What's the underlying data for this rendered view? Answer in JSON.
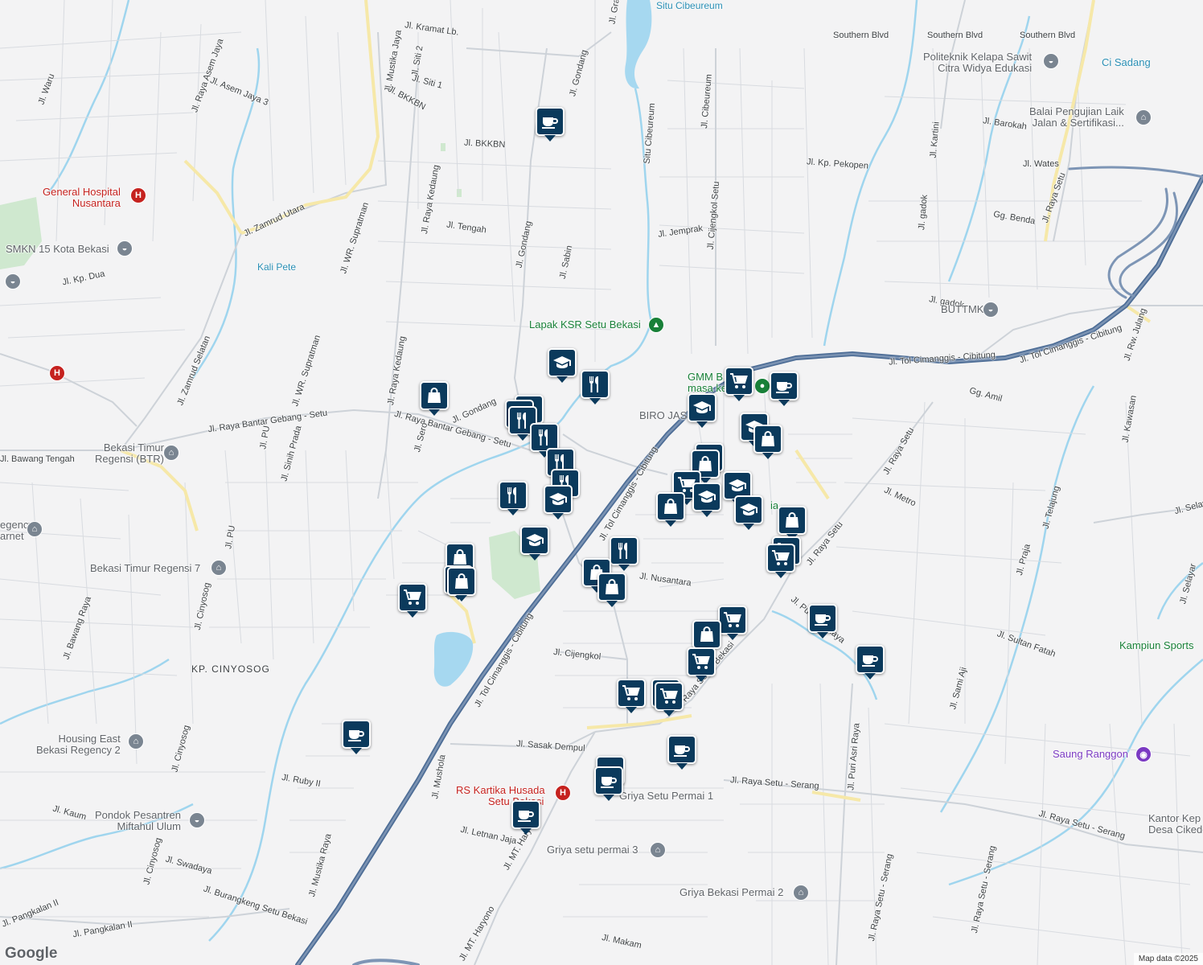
{
  "map": {
    "provider_logo": "Google",
    "attribution": "Map data ©2025",
    "road_labels": [
      "Jl. Kramat Lb.",
      "Jl. Mustika Jaya",
      "Jl. Siti 2",
      "Jl. Siti 1",
      "Jl. BKKBN",
      "Jl. BKKBN",
      "Jl. Gondang",
      "Jl. Raya Asem Jaya",
      "Jl. Asem Jaya 3",
      "Jl. Waru",
      "Jl. Zamrud Utara",
      "Jl. WR. Supratman",
      "Jl. Raya Kedaung",
      "Jl. Tengah",
      "Jl. Gondang",
      "Jl. Sabin",
      "Jl. Kp. Dua",
      "Jl. Zamrud Selatan",
      "Jl. WR. Supratman",
      "Jl. Raya Kedaung",
      "Jl. Raya Bantar Gebang - Setu",
      "Jl. Gondang",
      "Jl. Raya Bantar Gebang - Setu",
      "Jl. Sero",
      "Jl. PU",
      "Jl. Sinih Prada",
      "Jl. Bawang Tengah",
      "Jl. PU",
      "Jl. Cinyosog",
      "Jl. Bawang Raya",
      "Jl. Cinyosog",
      "Jl. Ruby II",
      "Jl. Kaum",
      "Jl. Cinyosog",
      "Jl. Swadaya",
      "Jl. Mustika Raya",
      "Jl. Burangkeng Setu Bekasi",
      "Jl. Pangkalan II",
      "Jl. Pangkalan II",
      "Jl. Tol Cimanggis - Cibitung",
      "Jl. Tol Cimanggis - Cibitung",
      "Jl. Tol Cimanggis - Cibitung",
      "Jl. Tol Cimanggis - Cibitung",
      "Jl. Cibeureum",
      "Jl. Jemprak",
      "Jl. Cijengkol Setu",
      "Jl. Kp. Pekopen",
      "Jl. Kartini",
      "Jl. Barokah",
      "Jl. Wates",
      "Jl. gadok",
      "Jl. Raya Setu",
      "Gg. Benda",
      "Jl. gadok",
      "Gg. Amil",
      "Jl. Rw. Julang",
      "Jl. Raya Setu",
      "Jl. Kawasan",
      "Jl. Metro",
      "Jl. Raya Setu",
      "Jl. Telajung",
      "Jl. Praja",
      "Jl. Selay",
      "Jl. Selayar",
      "Jl. Nusantara",
      "Jl. Cijengkol",
      "Jl. Raya Setu - Bekasi",
      "Jl. Puri Asri Raya",
      "Jl. Sultan Fatah",
      "Jl. Sami Aji",
      "Jl. Sasak Dempul",
      "Jl. Mushola",
      "Jl. Raya Setu - Serang",
      "Jl. Puri Asri Raya",
      "Jl. Letnan Jaja",
      "Jl. MT. Haryono",
      "Jl. MT. Haryono",
      "Jl. Makam",
      "Jl. Raya Setu - Serang",
      "Jl. Raya Setu - Serang",
      "Jl. Raya Setu - Serang",
      "Southern Blvd",
      "Southern Blvd",
      "Southern Blvd",
      "Jl. Gra",
      "Situ Cibeureum"
    ],
    "water_labels": [
      "Situ Cibeureum",
      "Kali Pete",
      "Ci Sadang"
    ],
    "area_labels": [
      "KP. CINYOSOG"
    ],
    "places": [
      {
        "name": "General Hospital Nusantara",
        "line1": "General Hospital",
        "line2": "Nusantara",
        "kind": "hospital"
      },
      {
        "name": "SMKN 15 Kota Bekasi",
        "line1": "SMKN 15 Kota Bekasi",
        "line2": "",
        "kind": "school"
      },
      {
        "name": "Politeknik Kelapa Sawit Citra Widya Edukasi",
        "line1": "Politeknik Kelapa Sawit",
        "line2": "Citra Widya Edukasi",
        "kind": "school"
      },
      {
        "name": "Balai Pengujian Laik Jalan & Sertifikasi...",
        "line1": "Balai Pengujian Laik",
        "line2": "Jalan & Sertifikasi...",
        "kind": "government"
      },
      {
        "name": "BUTTMKP",
        "line1": "BUTTMKP",
        "line2": "",
        "kind": "school"
      },
      {
        "name": "Lapak KSR Setu Bekasi",
        "line1": "Lapak KSR Setu Bekasi",
        "line2": "",
        "kind": "park"
      },
      {
        "name": "GMM B... masa ke...",
        "line1": "GMM B",
        "line2": "masa ke",
        "kind": "other"
      },
      {
        "name": "BIRO JASA ... NAH",
        "line1": "BIRO JAS",
        "line2": "",
        "kind": "business"
      },
      {
        "name": "Bekasi Timur Regensi (BTR)",
        "line1": "Bekasi Timur",
        "line2": "Regensi (BTR)",
        "kind": "residential"
      },
      {
        "name": "Bekasi Timur Regensi 7",
        "line1": "Bekasi Timur Regensi 7",
        "line2": "",
        "kind": "residential"
      },
      {
        "name": "...egency ...arnet",
        "line1": "egency",
        "line2": "arnet",
        "kind": "residential"
      },
      {
        "name": "Housing East Bekasi Regency 2",
        "line1": "Housing East",
        "line2": "Bekasi Regency 2",
        "kind": "residential"
      },
      {
        "name": "Pondok Pesantren Miftahul Ulum",
        "line1": "Pondok Pesantren",
        "line2": "Miftahul Ulum",
        "kind": "school"
      },
      {
        "name": "RS Kartika Husada Setu Bekasi",
        "line1": "RS Kartika Husada",
        "line2": "Setu Bekasi",
        "kind": "hospital"
      },
      {
        "name": "Griya Setu Permai 1",
        "line1": "Griya Setu Permai 1",
        "line2": "",
        "kind": "residential"
      },
      {
        "name": "Griya setu permai 3",
        "line1": "Griya setu permai 3",
        "line2": "",
        "kind": "residential"
      },
      {
        "name": "Griya Bekasi Permai 2",
        "line1": "Griya Bekasi Permai 2",
        "line2": "",
        "kind": "residential"
      },
      {
        "name": "Saung Ranggon",
        "line1": "Saung Ranggon",
        "line2": "",
        "kind": "attraction"
      },
      {
        "name": "Kantor Kep... Desa Cikedo...",
        "line1": "Kantor Kep",
        "line2": "Desa Cikedo",
        "kind": "government"
      },
      {
        "name": "Kampiun Sports ...",
        "line1": "Kampiun Sports",
        "line2": "",
        "kind": "sports"
      },
      {
        "name": "...nd...ia",
        "line1": "ia",
        "line2": "",
        "kind": "other"
      }
    ],
    "markers": [
      {
        "kind": "cafe"
      },
      {
        "kind": "education"
      },
      {
        "kind": "restaurant"
      },
      {
        "kind": "shopping"
      },
      {
        "kind": "restaurant"
      },
      {
        "kind": "restaurant"
      },
      {
        "kind": "restaurant"
      },
      {
        "kind": "restaurant"
      },
      {
        "kind": "restaurant"
      },
      {
        "kind": "restaurant"
      },
      {
        "kind": "education"
      },
      {
        "kind": "restaurant"
      },
      {
        "kind": "education"
      },
      {
        "kind": "shopping"
      },
      {
        "kind": "shopping"
      },
      {
        "kind": "shopping"
      },
      {
        "kind": "grocery"
      },
      {
        "kind": "restaurant"
      },
      {
        "kind": "shopping"
      },
      {
        "kind": "shopping"
      },
      {
        "kind": "grocery"
      },
      {
        "kind": "cafe"
      },
      {
        "kind": "education"
      },
      {
        "kind": "education"
      },
      {
        "kind": "shopping"
      },
      {
        "kind": "shopping"
      },
      {
        "kind": "shopping"
      },
      {
        "kind": "grocery"
      },
      {
        "kind": "education"
      },
      {
        "kind": "shopping"
      },
      {
        "kind": "education"
      },
      {
        "kind": "education"
      },
      {
        "kind": "shopping"
      },
      {
        "kind": "grocery"
      },
      {
        "kind": "grocery"
      },
      {
        "kind": "cafe"
      },
      {
        "kind": "grocery"
      },
      {
        "kind": "shopping"
      },
      {
        "kind": "grocery"
      },
      {
        "kind": "cafe"
      },
      {
        "kind": "grocery"
      },
      {
        "kind": "grocery"
      },
      {
        "kind": "grocery"
      },
      {
        "kind": "cafe"
      },
      {
        "kind": "cafe"
      },
      {
        "kind": "cafe"
      },
      {
        "kind": "cafe"
      },
      {
        "kind": "cafe"
      }
    ]
  }
}
